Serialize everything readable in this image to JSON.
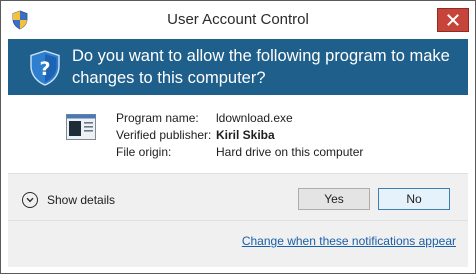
{
  "window": {
    "title": "User Account Control"
  },
  "banner": {
    "question": "Do you want to allow the following program to make changes to this computer?"
  },
  "details": {
    "program_name_label": "Program name:",
    "program_name_value": "ldownload.exe",
    "publisher_label": "Verified publisher:",
    "publisher_value": "Kiril Skiba",
    "origin_label": "File origin:",
    "origin_value": "Hard drive on this computer"
  },
  "footer": {
    "show_details_label": "Show details",
    "yes_label": "Yes",
    "no_label": "No",
    "notifications_link": "Change when these notifications appear"
  },
  "icons": {
    "title": "uac-shield-icon",
    "banner": "uac-shield-question-icon",
    "program": "program-window-icon",
    "close": "close-icon",
    "details": "chevron-down-icon"
  },
  "colors": {
    "banner_bg": "#1f5f8b",
    "close_bg": "#c7443a",
    "link": "#1a5fa8",
    "footer_bg": "#f0f0f0"
  }
}
